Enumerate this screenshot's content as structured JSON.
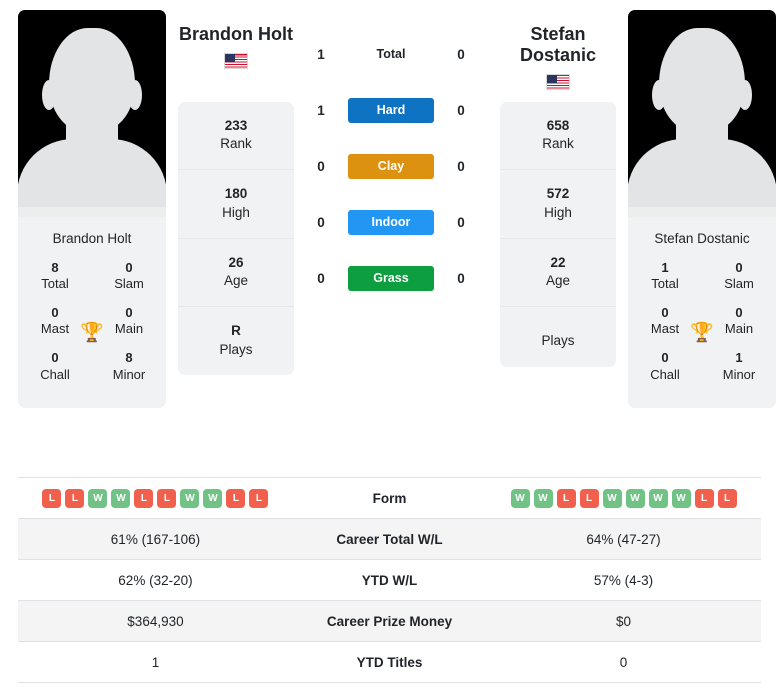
{
  "players": {
    "left": {
      "name": "Brandon Holt",
      "card_name": "Brandon Holt",
      "flag": "us-flag-icon",
      "titles": [
        {
          "value": "8",
          "label": "Total"
        },
        {
          "value": "0",
          "label": "Slam"
        },
        {
          "value": "0",
          "label": "Mast"
        },
        {
          "value": "0",
          "label": "Main"
        },
        {
          "value": "0",
          "label": "Chall"
        },
        {
          "value": "8",
          "label": "Minor"
        }
      ],
      "info": [
        {
          "value": "233",
          "label": "Rank"
        },
        {
          "value": "180",
          "label": "High"
        },
        {
          "value": "26",
          "label": "Age"
        },
        {
          "value": "R",
          "label": "Plays"
        }
      ]
    },
    "right": {
      "name": "Stefan Dostanic",
      "card_name": "Stefan Dostanic",
      "flag": "us-flag-icon",
      "titles": [
        {
          "value": "1",
          "label": "Total"
        },
        {
          "value": "0",
          "label": "Slam"
        },
        {
          "value": "0",
          "label": "Mast"
        },
        {
          "value": "0",
          "label": "Main"
        },
        {
          "value": "0",
          "label": "Chall"
        },
        {
          "value": "1",
          "label": "Minor"
        }
      ],
      "info": [
        {
          "value": "658",
          "label": "Rank"
        },
        {
          "value": "572",
          "label": "High"
        },
        {
          "value": "22",
          "label": "Age"
        },
        {
          "value": "",
          "label": "Plays"
        }
      ]
    }
  },
  "trophy_icon": "🏆",
  "surfaces": [
    {
      "label": "Total",
      "left": "1",
      "right": "0",
      "color": "",
      "badge": false
    },
    {
      "label": "Hard",
      "left": "1",
      "right": "0",
      "color": "#0f73c4",
      "badge": true
    },
    {
      "label": "Clay",
      "left": "0",
      "right": "0",
      "color": "#dd9110",
      "badge": true
    },
    {
      "label": "Indoor",
      "left": "0",
      "right": "0",
      "color": "#2196f3",
      "badge": true
    },
    {
      "label": "Grass",
      "left": "0",
      "right": "0",
      "color": "#0d9e3f",
      "badge": true
    }
  ],
  "form": {
    "label": "Form",
    "left": [
      "L",
      "L",
      "W",
      "W",
      "L",
      "L",
      "W",
      "W",
      "L",
      "L"
    ],
    "right": [
      "W",
      "W",
      "L",
      "L",
      "W",
      "W",
      "W",
      "W",
      "L",
      "L"
    ]
  },
  "table_rows": [
    {
      "label": "Career Total W/L",
      "left": "61% (167-106)",
      "right": "64% (47-27)",
      "shaded": true
    },
    {
      "label": "YTD W/L",
      "left": "62% (32-20)",
      "right": "57% (4-3)",
      "shaded": false
    },
    {
      "label": "Career Prize Money",
      "left": "$364,930",
      "right": "$0",
      "shaded": true
    },
    {
      "label": "YTD Titles",
      "left": "1",
      "right": "0",
      "shaded": false
    }
  ],
  "colors": {
    "win": "#71c285",
    "loss": "#f0604d",
    "card_bg": "#f1f2f3",
    "row_shade": "#f4f4f5",
    "border": "#dee2e6",
    "trophy": "#2f6cb5"
  }
}
